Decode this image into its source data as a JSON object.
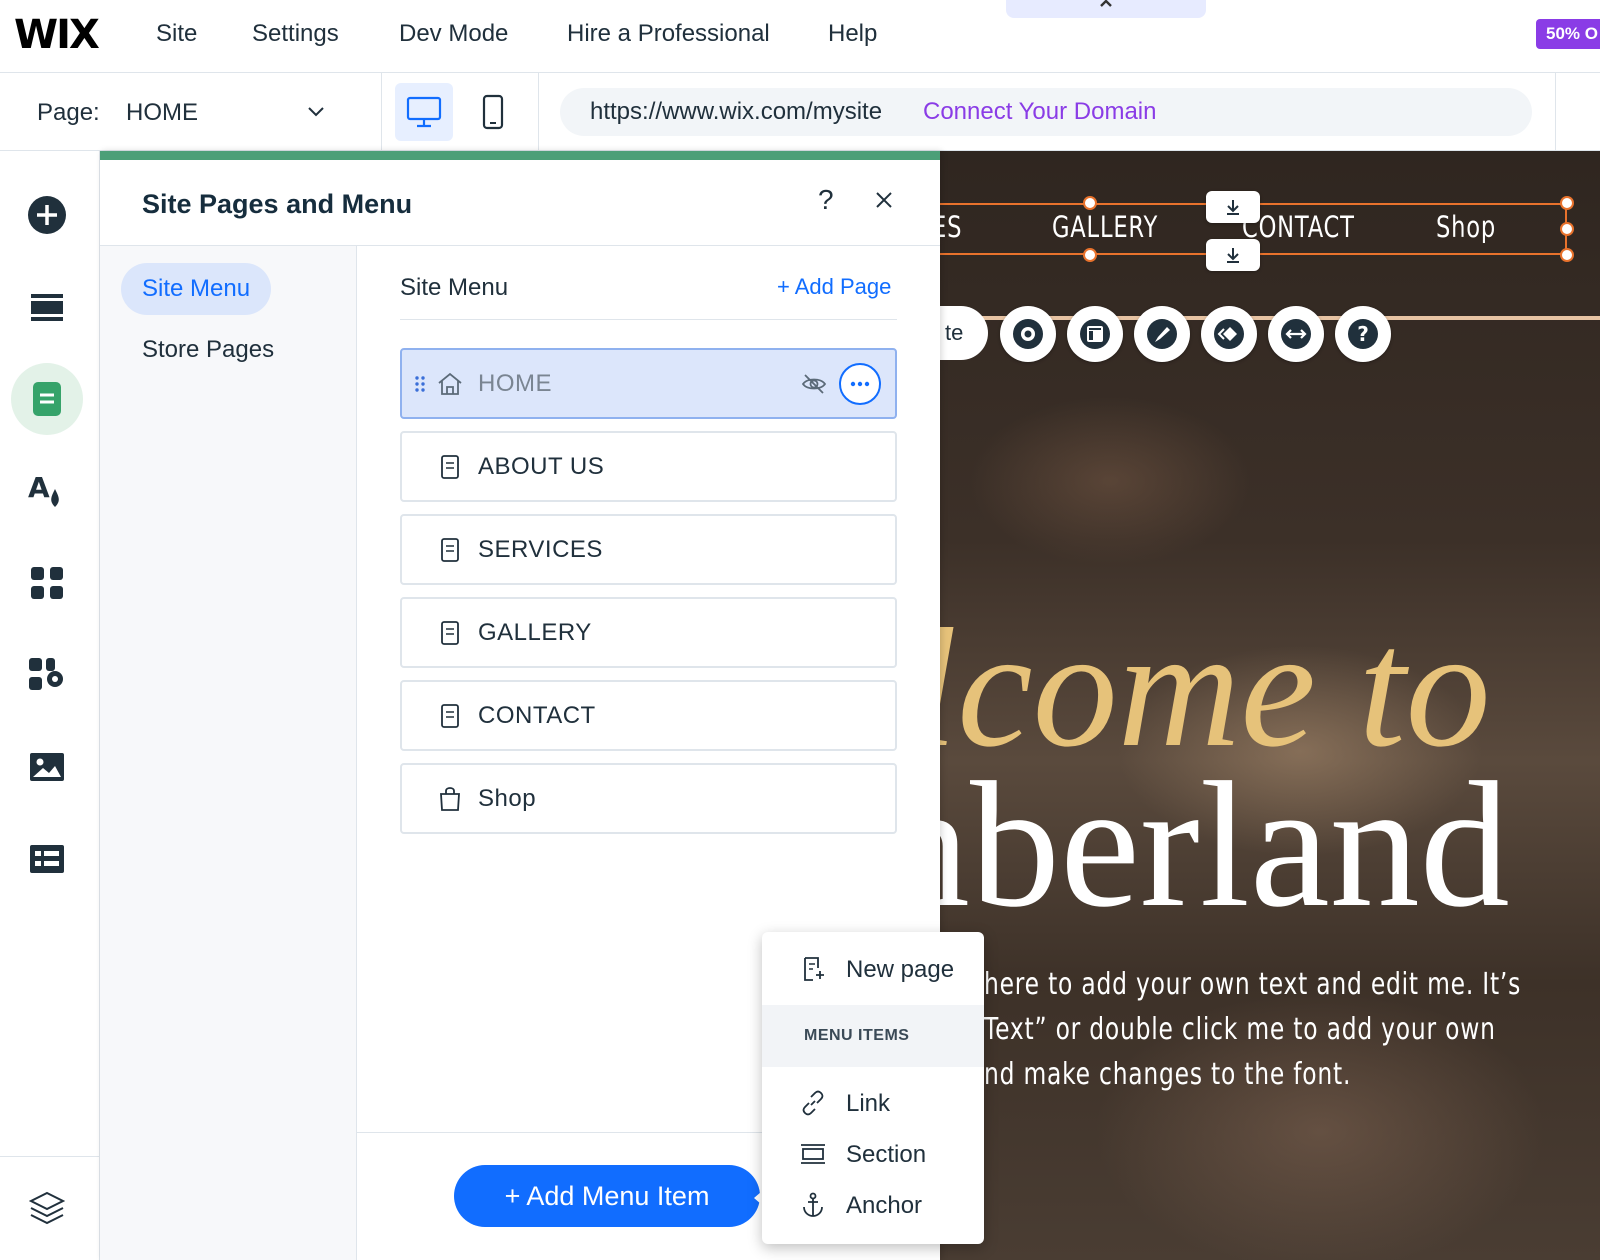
{
  "topbar": {
    "logo": "WIX",
    "menu": [
      "Site",
      "Settings",
      "Dev Mode",
      "Hire a Professional",
      "Help"
    ],
    "promo": "50% O"
  },
  "subbar": {
    "page_label": "Page:",
    "page_value": "HOME",
    "url": "https://www.wix.com/mysite",
    "domain_link": "Connect Your Domain"
  },
  "rail": {
    "icons": [
      "add-elements-icon",
      "sections-icon",
      "pages-icon",
      "site-design-icon",
      "apps-icon",
      "business-tools-icon",
      "media-icon",
      "cms-icon",
      "layers-icon"
    ],
    "active": "pages-icon"
  },
  "panel": {
    "title": "Site Pages and Menu",
    "help": "?",
    "nav": [
      "Site Menu",
      "Store Pages"
    ],
    "list_title": "Site Menu",
    "add_page": "+ Add Page",
    "pages": [
      {
        "label": "HOME",
        "icon": "home-icon",
        "selected": true
      },
      {
        "label": "ABOUT US",
        "icon": "page-icon"
      },
      {
        "label": "SERVICES",
        "icon": "page-icon"
      },
      {
        "label": "GALLERY",
        "icon": "page-icon"
      },
      {
        "label": "CONTACT",
        "icon": "page-icon"
      },
      {
        "label": "Shop",
        "icon": "shopping-bag-icon"
      }
    ],
    "add_menu_item": "+ Add Menu Item"
  },
  "dropdown": {
    "new_page": "New page",
    "section_label": "MENU ITEMS",
    "items": [
      "Link",
      "Section",
      "Anchor"
    ]
  },
  "canvas": {
    "nav": [
      "ES",
      "GALLERY",
      "CONTACT",
      "Shop"
    ],
    "tool_pill": "te",
    "tools": [
      "settings-gear-icon",
      "layout-icon",
      "design-brush-icon",
      "animation-icon",
      "stretch-icon",
      "help-icon"
    ],
    "hero_line1": "lcome to",
    "hero_line2": "nberland",
    "hero_paragraph": [
      "here to add your own text and edit me. It’s",
      "Text” or double click me to add your own",
      "nd make changes to the font."
    ],
    "colors": {
      "selection": "#e8722c",
      "hero_gold": "#e6c27a"
    }
  },
  "colors": {
    "accent_blue": "#116dff",
    "brand_purple": "#8a3ce6",
    "panel_green": "#4c9f78"
  }
}
